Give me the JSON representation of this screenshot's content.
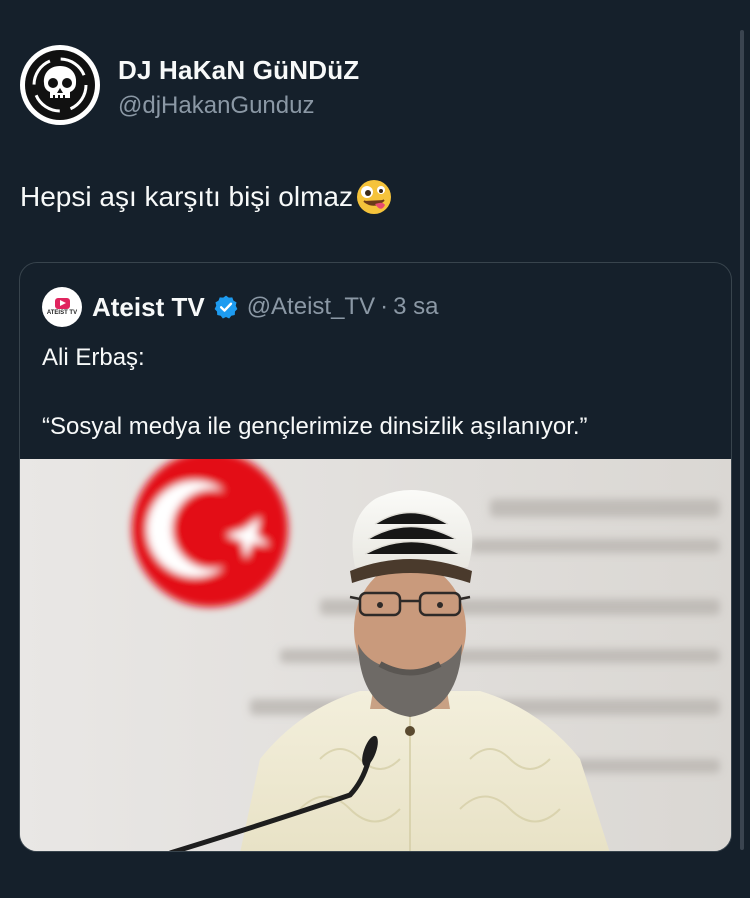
{
  "post": {
    "author": {
      "display_name": "DJ HaKaN GüNDüZ",
      "handle": "@djHakanGunduz",
      "avatar_icon": "skull-avatar-icon"
    },
    "text": "Hepsi aşı karşıtı bişi olmaz",
    "emoji": "zany-face-emoji"
  },
  "quote": {
    "avatar_label": "ATEIST TV",
    "name": "Ateist TV",
    "verified_icon": "verified-badge-icon",
    "verified_color": "#1d9bf0",
    "handle": "@Ateist_TV",
    "separator": "·",
    "time": "3 sa",
    "line1": "Ali Erbaş:",
    "line2": "“Sosyal medya ile gençlerimize dinsizlik aşılanıyor.”",
    "media": {
      "type": "photo",
      "subject": "man-in-white-turban-at-podium-photo",
      "flag_color": "#e30a17"
    }
  },
  "colors": {
    "background": "#15202b",
    "text": "#f7f9f9",
    "muted": "#8b98a5",
    "border": "#38444d"
  }
}
